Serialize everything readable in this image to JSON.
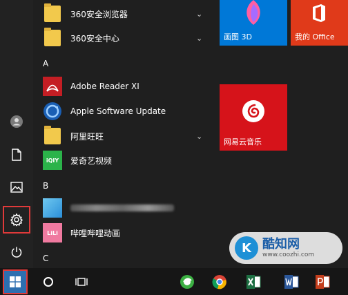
{
  "app_list": {
    "items": [
      {
        "label": "360安全浏览器",
        "icon": "folder-icon",
        "expandable": true
      },
      {
        "label": "360安全中心",
        "icon": "folder-icon",
        "expandable": true
      },
      {
        "label": "Adobe Reader XI",
        "icon": "adobe-reader-icon",
        "expandable": false
      },
      {
        "label": "Apple Software Update",
        "icon": "apple-update-icon",
        "expandable": false
      },
      {
        "label": "阿里旺旺",
        "icon": "folder-icon",
        "expandable": true
      },
      {
        "label": "爱奇艺视频",
        "icon": "iqiyi-icon",
        "expandable": false
      },
      {
        "label": "哔哩哔哩动画",
        "icon": "bilibili-icon",
        "expandable": false
      }
    ],
    "headers": [
      "A",
      "B",
      "C"
    ],
    "chevron": "⌄",
    "iqiyi_badge": "iQIY",
    "bilibili_badge": "LiLi"
  },
  "tiles": [
    {
      "label": "画图 3D",
      "color": "#0078d7"
    },
    {
      "label": "我的 Office",
      "color": "#e03a1a"
    },
    {
      "label": "网易云音乐",
      "color": "#d6131a"
    }
  ],
  "watermark": {
    "title": "酷知网",
    "url": "www.coozhi.com",
    "logo": "K"
  },
  "colors": {
    "highlight": "#e03a3a",
    "start_bg": "#2d6fb0"
  }
}
